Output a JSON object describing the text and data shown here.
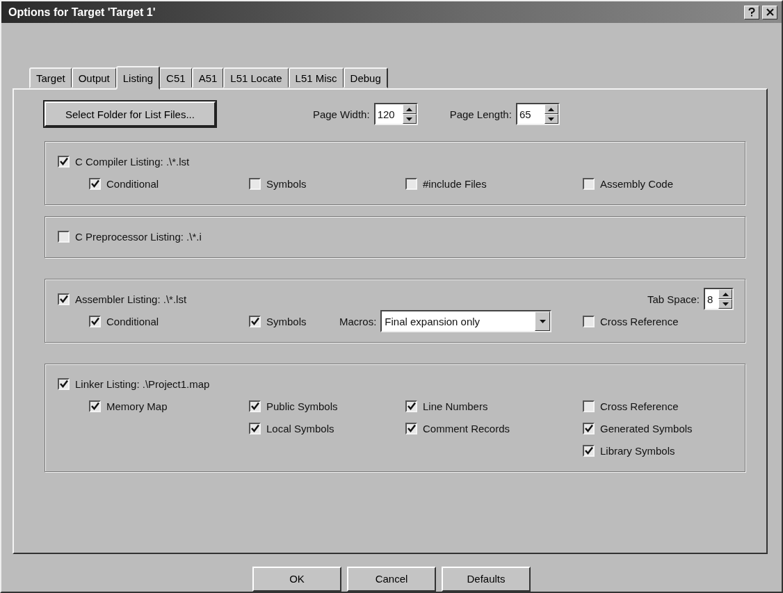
{
  "window": {
    "title": "Options for Target 'Target 1'"
  },
  "tabs": [
    {
      "label": "Target",
      "selected": false
    },
    {
      "label": "Output",
      "selected": false
    },
    {
      "label": "Listing",
      "selected": true
    },
    {
      "label": "C51",
      "selected": false
    },
    {
      "label": "A51",
      "selected": false
    },
    {
      "label": "L51 Locate",
      "selected": false
    },
    {
      "label": "L51 Misc",
      "selected": false
    },
    {
      "label": "Debug",
      "selected": false
    }
  ],
  "folder_button": "Select Folder for List Files...",
  "spinners": [
    {
      "label": "Page Width:",
      "value": "120"
    },
    {
      "label": "Page Length:",
      "value": "65"
    }
  ],
  "groups": [
    {
      "label": "C Compiler Listing:  .\\*.lst",
      "checked": true,
      "columns": [
        [
          {
            "kind": "checkbox",
            "label": "Conditional",
            "checked": true
          }
        ],
        [
          {
            "kind": "checkbox",
            "label": "Symbols",
            "checked": false
          }
        ],
        [
          {
            "kind": "checkbox",
            "label": "#include Files",
            "checked": false
          }
        ],
        [
          {
            "kind": "checkbox",
            "label": "Assembly Code",
            "checked": false
          }
        ]
      ]
    },
    {
      "label": "C Preprocessor Listing:  .\\*.i",
      "checked": false
    },
    {
      "label": "Assembler Listing:  .\\*.lst",
      "checked": true,
      "tab_space": {
        "label": "Tab Space:",
        "value": "8"
      },
      "columns": [
        [
          {
            "kind": "checkbox",
            "label": "Conditional",
            "checked": true
          }
        ],
        [
          {
            "kind": "checkbox",
            "label": "Symbols",
            "checked": true
          }
        ],
        [
          {
            "kind": "combo",
            "label": "Macros:",
            "value": "Final expansion only"
          }
        ],
        [
          {
            "kind": "checkbox",
            "label": "Cross Reference",
            "checked": false
          }
        ]
      ]
    },
    {
      "label": "Linker Listing:  .\\Project1.map",
      "checked": true,
      "columns": [
        [
          {
            "kind": "checkbox",
            "label": "Memory Map",
            "checked": true
          }
        ],
        [
          {
            "kind": "checkbox",
            "label": "Public Symbols",
            "checked": true
          },
          {
            "kind": "checkbox",
            "label": "Local Symbols",
            "checked": true
          }
        ],
        [
          {
            "kind": "checkbox",
            "label": "Line Numbers",
            "checked": true
          },
          {
            "kind": "checkbox",
            "label": "Comment Records",
            "checked": true
          }
        ],
        [
          {
            "kind": "checkbox",
            "label": "Cross Reference",
            "checked": false
          },
          {
            "kind": "checkbox",
            "label": "Generated Symbols",
            "checked": true
          },
          {
            "kind": "checkbox",
            "label": "Library Symbols",
            "checked": true
          }
        ]
      ]
    }
  ],
  "buttons": [
    "OK",
    "Cancel",
    "Defaults"
  ]
}
